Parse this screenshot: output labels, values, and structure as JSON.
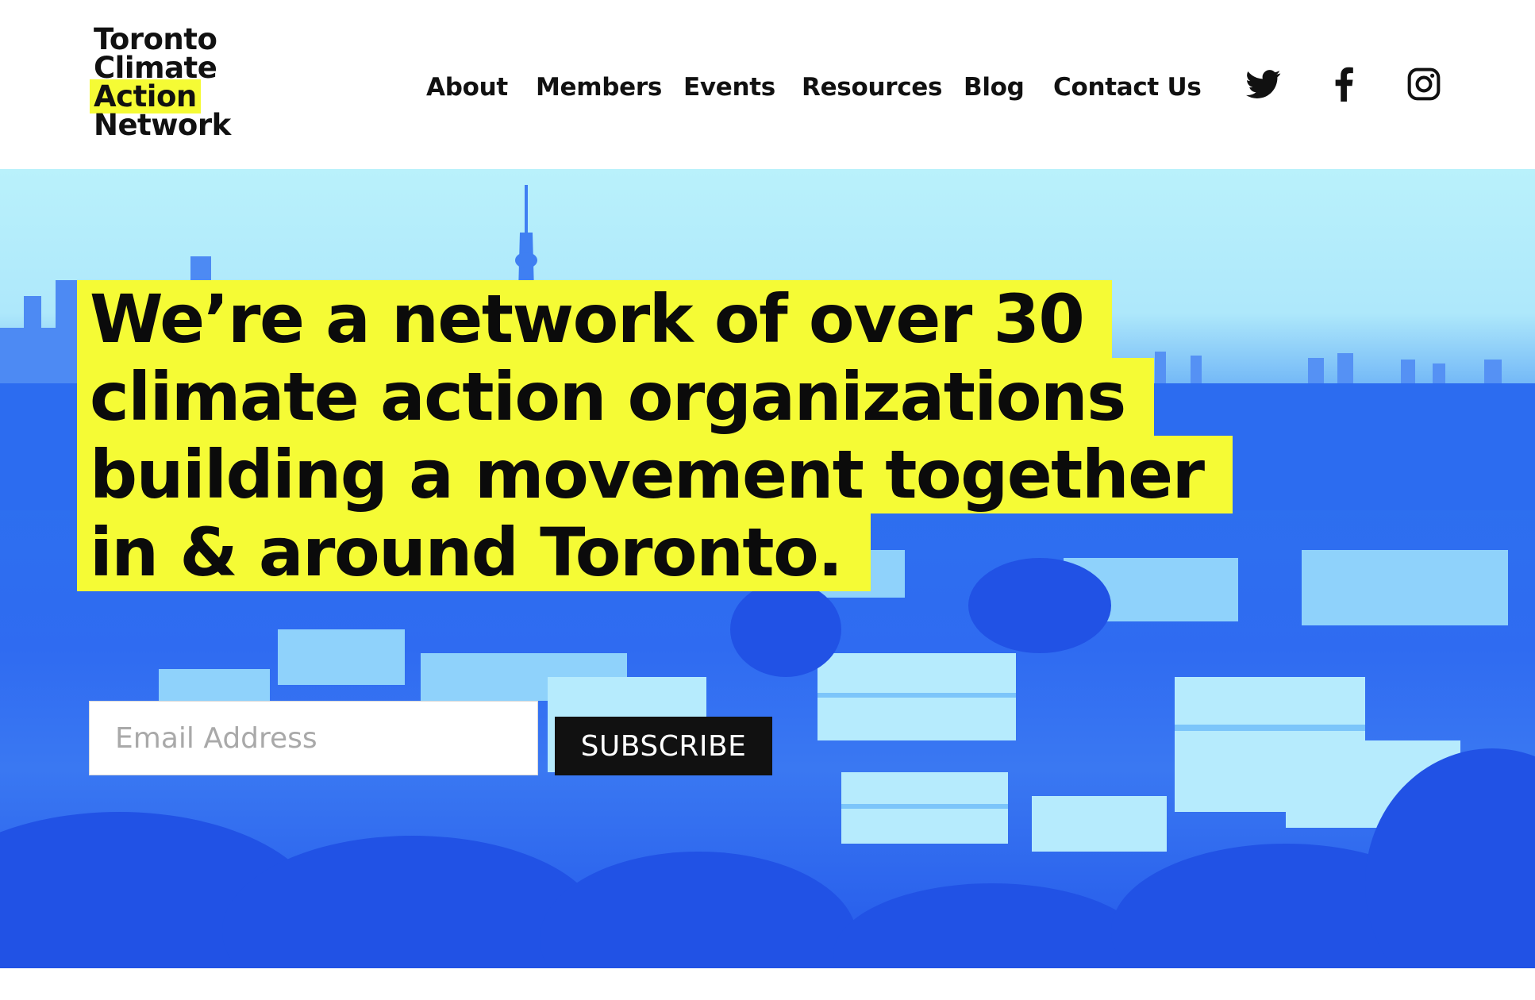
{
  "logo": {
    "lines": [
      "Toronto",
      "Climate",
      "Action",
      "Network"
    ],
    "highlight_color": "#f5fb35"
  },
  "nav": {
    "items": [
      {
        "label": "About"
      },
      {
        "label": "Members"
      },
      {
        "label": "Events"
      },
      {
        "label": "Resources"
      },
      {
        "label": "Blog"
      },
      {
        "label": "Contact Us"
      }
    ]
  },
  "social": {
    "icons": [
      "twitter-icon",
      "facebook-icon",
      "instagram-icon"
    ]
  },
  "hero": {
    "headline_lines": [
      "We’re a network of over 30",
      "climate action organizations",
      "building a movement together",
      "in & around Toronto."
    ],
    "highlight_color": "#f5fb35",
    "tint_color": "#2f6bf1"
  },
  "subscribe": {
    "placeholder": "Email Address",
    "value": "",
    "button_label": "SUBSCRIBE"
  }
}
